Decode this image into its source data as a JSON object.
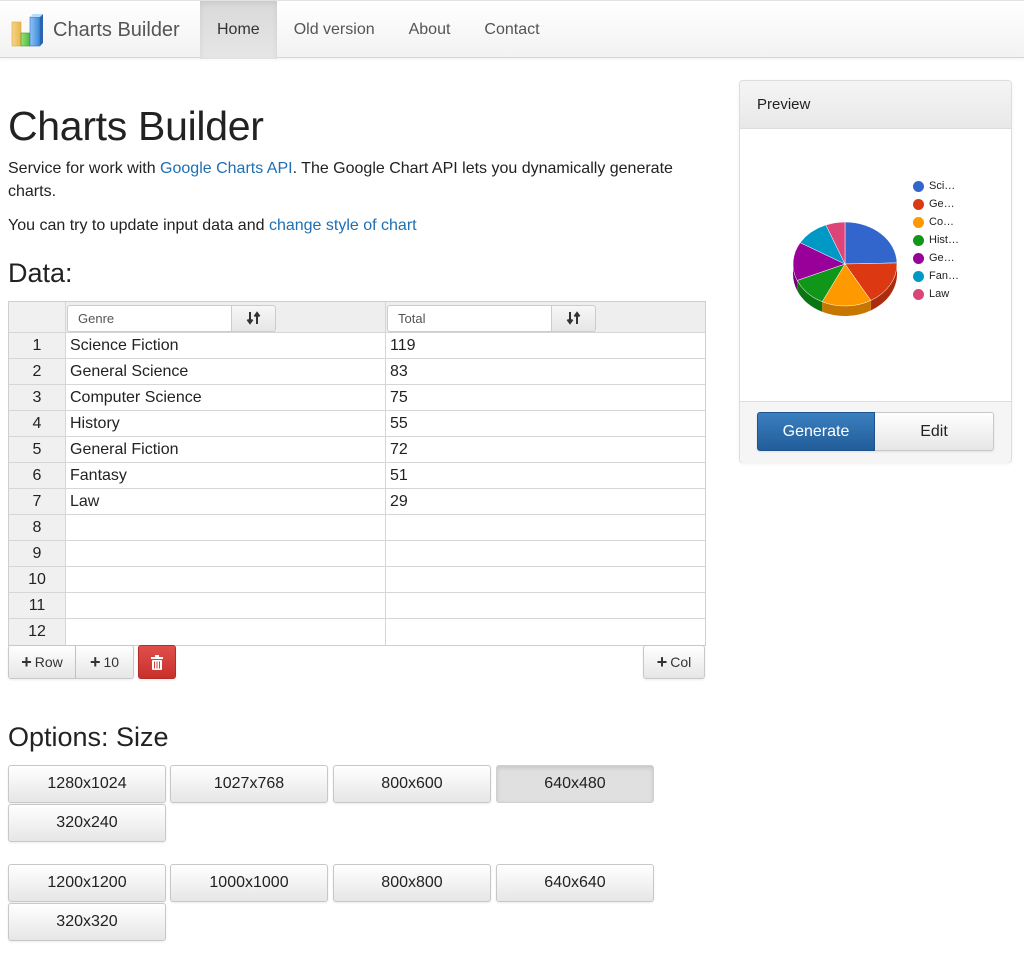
{
  "navbar": {
    "brand": "Charts Builder",
    "items": [
      {
        "label": "Home",
        "active": true
      },
      {
        "label": "Old version",
        "active": false
      },
      {
        "label": "About",
        "active": false
      },
      {
        "label": "Contact",
        "active": false
      }
    ]
  },
  "main": {
    "title": "Charts Builder",
    "intro_prefix": "Service for work with ",
    "intro_link": "Google Charts API",
    "intro_suffix": ". The Google Chart API lets you dynamically generate charts.",
    "update_prefix": "You can try to update input data and ",
    "update_link": "change style of chart"
  },
  "data_section": {
    "title": "Data:",
    "columns": [
      {
        "value": "Genre",
        "sort_icon": "sort-icon"
      },
      {
        "value": "Total",
        "sort_icon": "sort-icon"
      }
    ],
    "rows": [
      {
        "index": "1",
        "genre": "Science Fiction",
        "total": "119"
      },
      {
        "index": "2",
        "genre": "General Science",
        "total": "83"
      },
      {
        "index": "3",
        "genre": "Computer Science",
        "total": "75"
      },
      {
        "index": "4",
        "genre": "History",
        "total": "55"
      },
      {
        "index": "5",
        "genre": "General Fiction",
        "total": "72"
      },
      {
        "index": "6",
        "genre": "Fantasy",
        "total": "51"
      },
      {
        "index": "7",
        "genre": "Law",
        "total": "29"
      },
      {
        "index": "8",
        "genre": "",
        "total": ""
      },
      {
        "index": "9",
        "genre": "",
        "total": ""
      },
      {
        "index": "10",
        "genre": "",
        "total": ""
      },
      {
        "index": "11",
        "genre": "",
        "total": ""
      },
      {
        "index": "12",
        "genre": "",
        "total": ""
      }
    ],
    "buttons": {
      "add_row": "Row",
      "add_ten": "10",
      "add_col": "Col",
      "delete_icon": "trash-icon"
    }
  },
  "options": {
    "title": "Options: Size",
    "group1": [
      {
        "label": "1280x1024",
        "active": false
      },
      {
        "label": "1027x768",
        "active": false
      },
      {
        "label": "800x600",
        "active": false
      },
      {
        "label": "640x480",
        "active": true
      },
      {
        "label": "320x240",
        "active": false
      }
    ],
    "group2": [
      {
        "label": "1200x1200",
        "active": false
      },
      {
        "label": "1000x1000",
        "active": false
      },
      {
        "label": "800x800",
        "active": false
      },
      {
        "label": "640x640",
        "active": false
      },
      {
        "label": "320x320",
        "active": false
      }
    ]
  },
  "preview": {
    "title": "Preview",
    "generate_label": "Generate",
    "edit_label": "Edit"
  },
  "chart_data": {
    "type": "pie",
    "style": "3d",
    "title": "",
    "legend_position": "right",
    "categories": [
      "Science Fiction",
      "General Science",
      "Computer Science",
      "History",
      "General Fiction",
      "Fantasy",
      "Law"
    ],
    "legend_labels": [
      "Sci…",
      "Ge…",
      "Co…",
      "Hist…",
      "Ge…",
      "Fan…",
      "Law"
    ],
    "values": [
      119,
      83,
      75,
      55,
      72,
      51,
      29
    ],
    "colors": [
      "#3366cc",
      "#dc3912",
      "#ff9900",
      "#109618",
      "#990099",
      "#0099c6",
      "#dd4477"
    ]
  }
}
